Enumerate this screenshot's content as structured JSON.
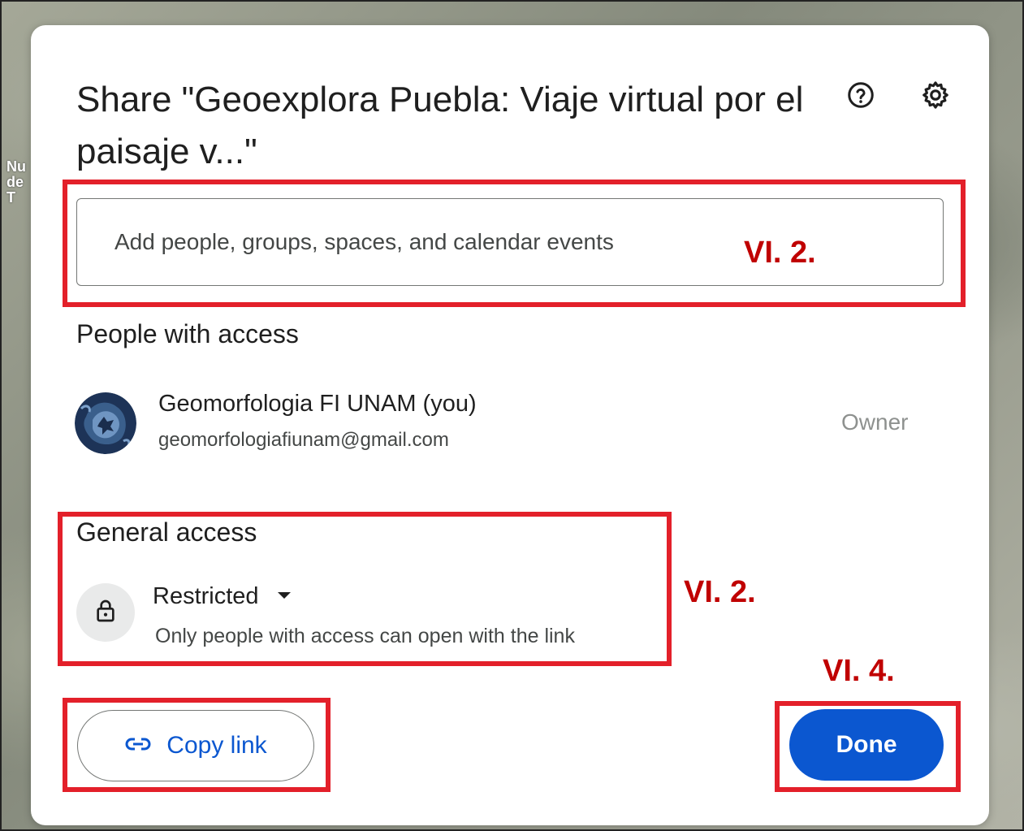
{
  "background": {
    "map_label": "Nu\nde\nT"
  },
  "dialog": {
    "title": "Share \"Geoexplora Puebla: Viaje virtual por el paisaje v...\"",
    "help_icon": "help-circle-icon",
    "settings_icon": "gear-icon",
    "add_people": {
      "placeholder": "Add people, groups, spaces, and calendar events",
      "value": ""
    },
    "people_with_access": {
      "heading": "People with access",
      "users": [
        {
          "name": "Geomorfologia FI UNAM (you)",
          "email": "geomorfologiafiunam@gmail.com",
          "role": "Owner"
        }
      ]
    },
    "general_access": {
      "heading": "General access",
      "icon": "lock-icon",
      "selected": "Restricted",
      "description": "Only people with access can open with the link"
    },
    "copy_link_label": "Copy link",
    "done_label": "Done"
  },
  "annotations": {
    "label_add_people": "VI. 2.",
    "label_general_access": "VI. 2.",
    "label_done": "VI. 4."
  },
  "colors": {
    "accent": "#0b57d0",
    "annotation": "#e3202a",
    "annotation_text": "#c00000"
  }
}
